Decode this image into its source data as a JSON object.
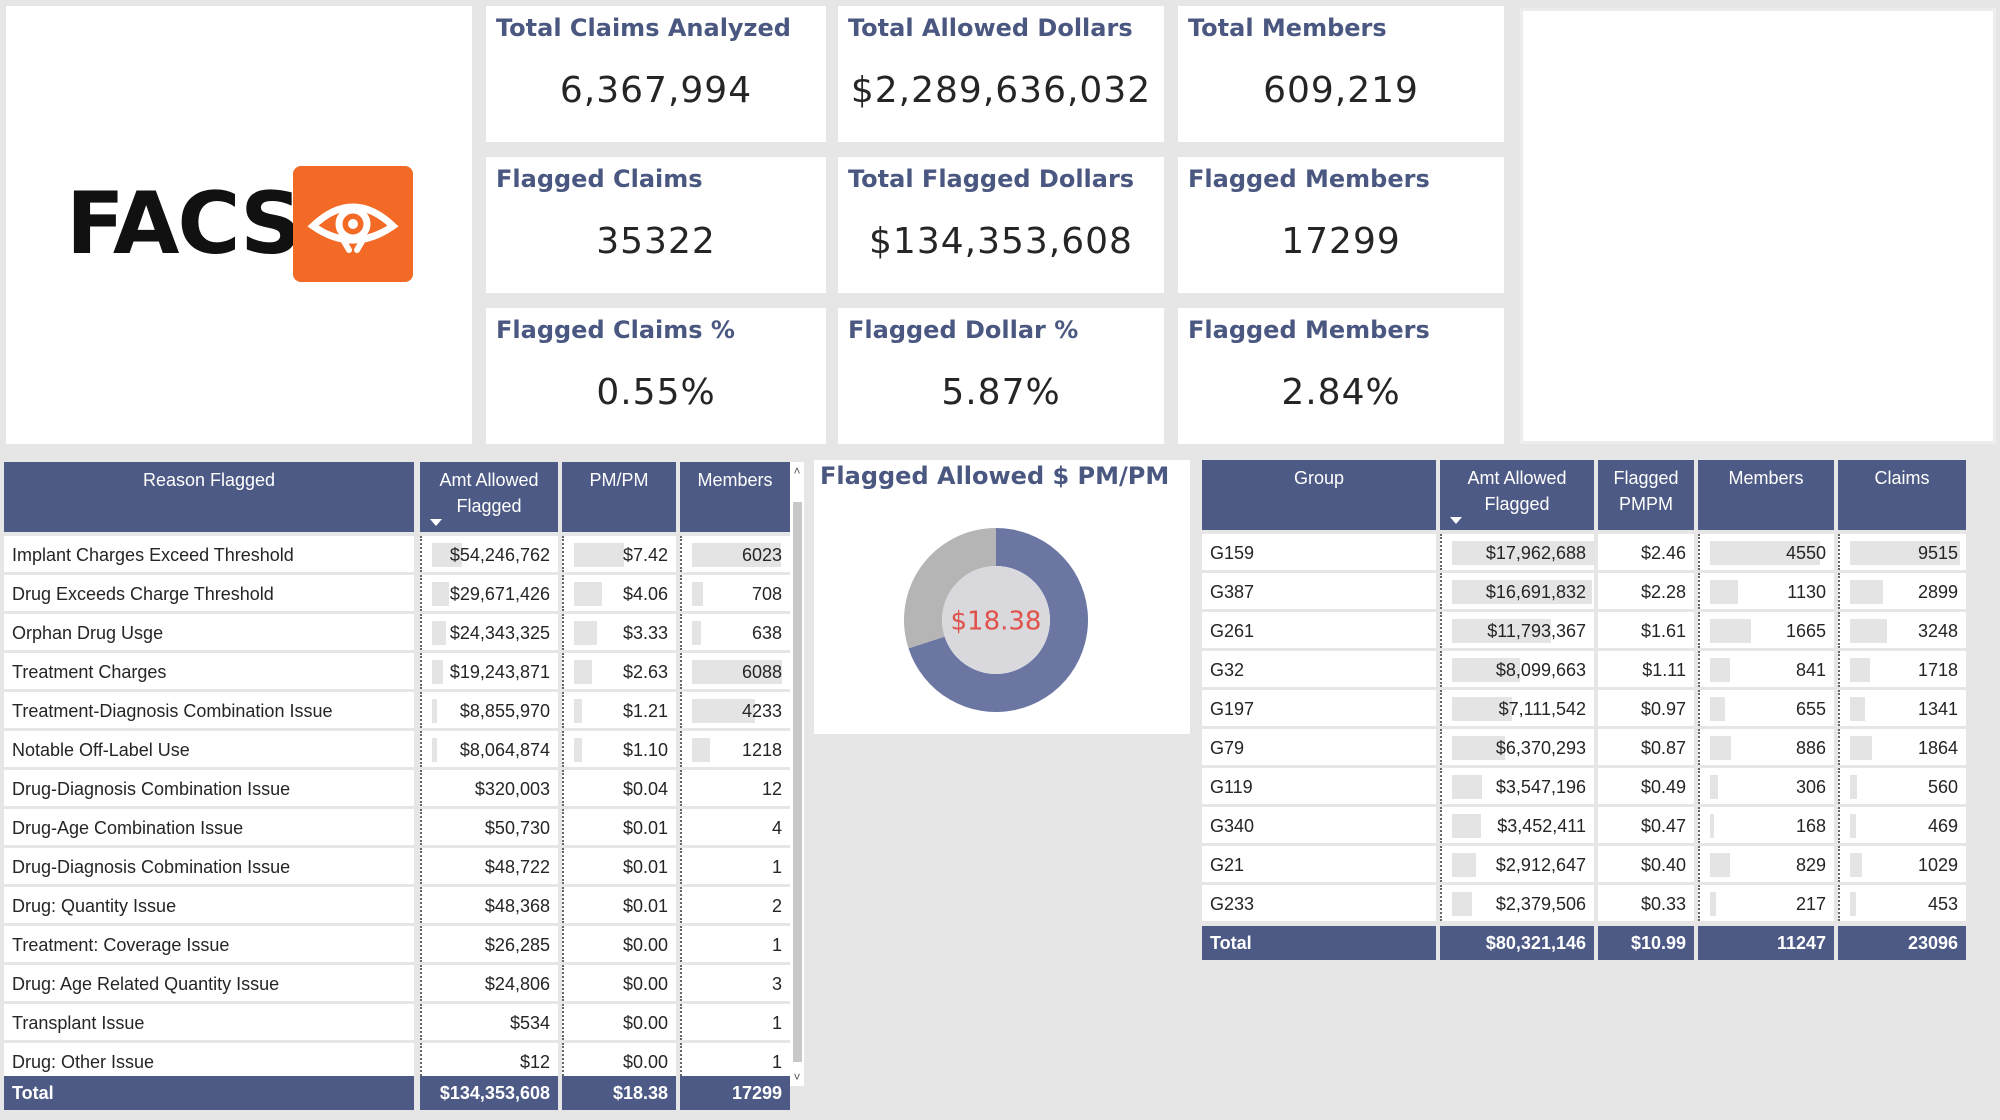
{
  "logo": {
    "text": "FACS",
    "icon": "eye-icon",
    "badge_color": "#f26a25"
  },
  "kpis": [
    {
      "title": "Total Claims Analyzed",
      "value": "6,367,994"
    },
    {
      "title": "Total Allowed Dollars",
      "value": "$2,289,636,032"
    },
    {
      "title": "Total Members",
      "value": "609,219"
    },
    {
      "title": "Flagged Claims",
      "value": "35322"
    },
    {
      "title": "Total Flagged Dollars",
      "value": "$134,353,608"
    },
    {
      "title": "Flagged Members",
      "value": "17299"
    },
    {
      "title": "Flagged Claims %",
      "value": "0.55%"
    },
    {
      "title": "Flagged Dollar %",
      "value": "5.87%"
    },
    {
      "title": "Flagged Members",
      "value": "2.84%"
    }
  ],
  "reason_table": {
    "headers": [
      "Reason Flagged",
      "Amt Allowed Flagged",
      "PM/PM",
      "Members"
    ],
    "rows": [
      {
        "reason": "Implant Charges Exceed Threshold",
        "amt": "$54,246,762",
        "pmpm": "$7.42",
        "members": "6023",
        "amt_frac": 1.0,
        "pmpm_frac": 1.0,
        "mem_frac": 0.99
      },
      {
        "reason": "Drug Exceeds Charge Threshold",
        "amt": "$29,671,426",
        "pmpm": "$4.06",
        "members": "708",
        "amt_frac": 0.55,
        "pmpm_frac": 0.55,
        "mem_frac": 0.12
      },
      {
        "reason": "Orphan Drug Usge",
        "amt": "$24,343,325",
        "pmpm": "$3.33",
        "members": "638",
        "amt_frac": 0.45,
        "pmpm_frac": 0.45,
        "mem_frac": 0.1
      },
      {
        "reason": "Treatment Charges",
        "amt": "$19,243,871",
        "pmpm": "$2.63",
        "members": "6088",
        "amt_frac": 0.35,
        "pmpm_frac": 0.35,
        "mem_frac": 1.0
      },
      {
        "reason": "Treatment-Diagnosis Combination Issue",
        "amt": "$8,855,970",
        "pmpm": "$1.21",
        "members": "4233",
        "amt_frac": 0.16,
        "pmpm_frac": 0.16,
        "mem_frac": 0.7
      },
      {
        "reason": "Notable Off-Label Use",
        "amt": "$8,064,874",
        "pmpm": "$1.10",
        "members": "1218",
        "amt_frac": 0.15,
        "pmpm_frac": 0.15,
        "mem_frac": 0.2
      },
      {
        "reason": "Drug-Diagnosis Combination Issue",
        "amt": "$320,003",
        "pmpm": "$0.04",
        "members": "12",
        "amt_frac": 0.006,
        "pmpm_frac": 0.005,
        "mem_frac": 0.002
      },
      {
        "reason": "Drug-Age Combination Issue",
        "amt": "$50,730",
        "pmpm": "$0.01",
        "members": "4",
        "amt_frac": 0.001,
        "pmpm_frac": 0.001,
        "mem_frac": 0.001
      },
      {
        "reason": "Drug-Diagnosis Cobmination Issue",
        "amt": "$48,722",
        "pmpm": "$0.01",
        "members": "1",
        "amt_frac": 0.001,
        "pmpm_frac": 0.001,
        "mem_frac": 0.0
      },
      {
        "reason": "Drug: Quantity Issue",
        "amt": "$48,368",
        "pmpm": "$0.01",
        "members": "2",
        "amt_frac": 0.001,
        "pmpm_frac": 0.001,
        "mem_frac": 0.0
      },
      {
        "reason": "Treatment: Coverage Issue",
        "amt": "$26,285",
        "pmpm": "$0.00",
        "members": "1",
        "amt_frac": 0.0,
        "pmpm_frac": 0.0,
        "mem_frac": 0.0
      },
      {
        "reason": "Drug: Age Related Quantity Issue",
        "amt": "$24,806",
        "pmpm": "$0.00",
        "members": "3",
        "amt_frac": 0.0,
        "pmpm_frac": 0.0,
        "mem_frac": 0.0
      },
      {
        "reason": "Transplant Issue",
        "amt": "$534",
        "pmpm": "$0.00",
        "members": "1",
        "amt_frac": 0.0,
        "pmpm_frac": 0.0,
        "mem_frac": 0.0
      },
      {
        "reason": "Drug: Other Issue",
        "amt": "$12",
        "pmpm": "$0.00",
        "members": "1",
        "amt_frac": 0.0,
        "pmpm_frac": 0.0,
        "mem_frac": 0.0
      }
    ],
    "total": {
      "label": "Total",
      "amt": "$134,353,608",
      "pmpm": "$18.38",
      "members": "17299"
    }
  },
  "scrollbar": {
    "up": "˄",
    "down": "˅"
  },
  "donut": {
    "title": "Flagged Allowed $ PM/PM",
    "center_label": "$18.38",
    "center_color": "#e0514a",
    "segments": [
      {
        "fraction": 0.7,
        "color": "#6b76a2"
      },
      {
        "fraction": 0.3,
        "color": "#b5b5b5"
      }
    ]
  },
  "group_table": {
    "headers": [
      "Group",
      "Amt Allowed Flagged",
      "Flagged PMPM",
      "Members",
      "Claims"
    ],
    "rows": [
      {
        "group": "G159",
        "amt": "$17,962,688",
        "pmpm": "$2.46",
        "members": "4550",
        "claims": "9515",
        "amt_frac": 1.0,
        "mem_frac": 1.0,
        "claims_frac": 1.0
      },
      {
        "group": "G387",
        "amt": "$16,691,832",
        "pmpm": "$2.28",
        "members": "1130",
        "claims": "2899",
        "amt_frac": 0.93,
        "mem_frac": 0.25,
        "claims_frac": 0.3
      },
      {
        "group": "G261",
        "amt": "$11,793,367",
        "pmpm": "$1.61",
        "members": "1665",
        "claims": "3248",
        "amt_frac": 0.66,
        "mem_frac": 0.37,
        "claims_frac": 0.34
      },
      {
        "group": "G32",
        "amt": "$8,099,663",
        "pmpm": "$1.11",
        "members": "841",
        "claims": "1718",
        "amt_frac": 0.45,
        "mem_frac": 0.18,
        "claims_frac": 0.18
      },
      {
        "group": "G197",
        "amt": "$7,111,542",
        "pmpm": "$0.97",
        "members": "655",
        "claims": "1341",
        "amt_frac": 0.4,
        "mem_frac": 0.14,
        "claims_frac": 0.14
      },
      {
        "group": "G79",
        "amt": "$6,370,293",
        "pmpm": "$0.87",
        "members": "886",
        "claims": "1864",
        "amt_frac": 0.35,
        "mem_frac": 0.19,
        "claims_frac": 0.2
      },
      {
        "group": "G119",
        "amt": "$3,547,196",
        "pmpm": "$0.49",
        "members": "306",
        "claims": "560",
        "amt_frac": 0.2,
        "mem_frac": 0.07,
        "claims_frac": 0.06
      },
      {
        "group": "G340",
        "amt": "$3,452,411",
        "pmpm": "$0.47",
        "members": "168",
        "claims": "469",
        "amt_frac": 0.19,
        "mem_frac": 0.04,
        "claims_frac": 0.05
      },
      {
        "group": "G21",
        "amt": "$2,912,647",
        "pmpm": "$0.40",
        "members": "829",
        "claims": "1029",
        "amt_frac": 0.16,
        "mem_frac": 0.18,
        "claims_frac": 0.11
      },
      {
        "group": "G233",
        "amt": "$2,379,506",
        "pmpm": "$0.33",
        "members": "217",
        "claims": "453",
        "amt_frac": 0.13,
        "mem_frac": 0.05,
        "claims_frac": 0.05
      }
    ],
    "total": {
      "label": "Total",
      "amt": "$80,321,146",
      "pmpm": "$10.99",
      "members": "11247",
      "claims": "23096"
    }
  },
  "colors": {
    "header_bg": "#4d5a85",
    "title_text": "#4a5780",
    "bar": "#e4e4e4",
    "background": "#e6e6e6"
  }
}
